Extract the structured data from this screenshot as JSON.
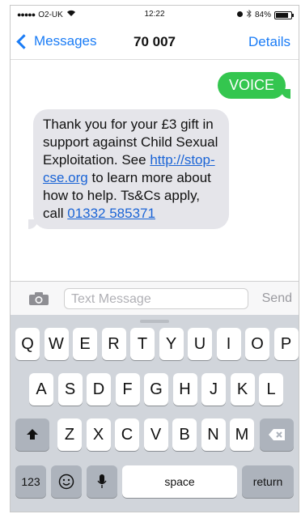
{
  "status_bar": {
    "carrier": "O2-UK",
    "time": "12:22",
    "battery": "84%",
    "battery_level": 0.84
  },
  "nav": {
    "back_label": "Messages",
    "title": "70 007",
    "details_label": "Details"
  },
  "messages": {
    "outgoing": "VOICE",
    "incoming": {
      "text_before": "Thank you for your £3 gift in support against Child Sexual Exploitation. See ",
      "link1": "http://stop-cse.org",
      "text_middle": " to learn more about how to help. Ts&Cs apply, call ",
      "link2": "01332 585371"
    }
  },
  "composer": {
    "placeholder": "Text Message",
    "send_label": "Send"
  },
  "keyboard": {
    "row1": [
      "Q",
      "W",
      "E",
      "R",
      "T",
      "Y",
      "U",
      "I",
      "O",
      "P"
    ],
    "row2": [
      "A",
      "S",
      "D",
      "F",
      "G",
      "H",
      "J",
      "K",
      "L"
    ],
    "row3": [
      "Z",
      "X",
      "C",
      "V",
      "B",
      "N",
      "M"
    ],
    "numbers_label": "123",
    "space_label": "space",
    "return_label": "return"
  },
  "colors": {
    "accent": "#1a7cf6",
    "outgoing_bubble": "#34c64f",
    "incoming_bubble": "#e5e5ea"
  }
}
